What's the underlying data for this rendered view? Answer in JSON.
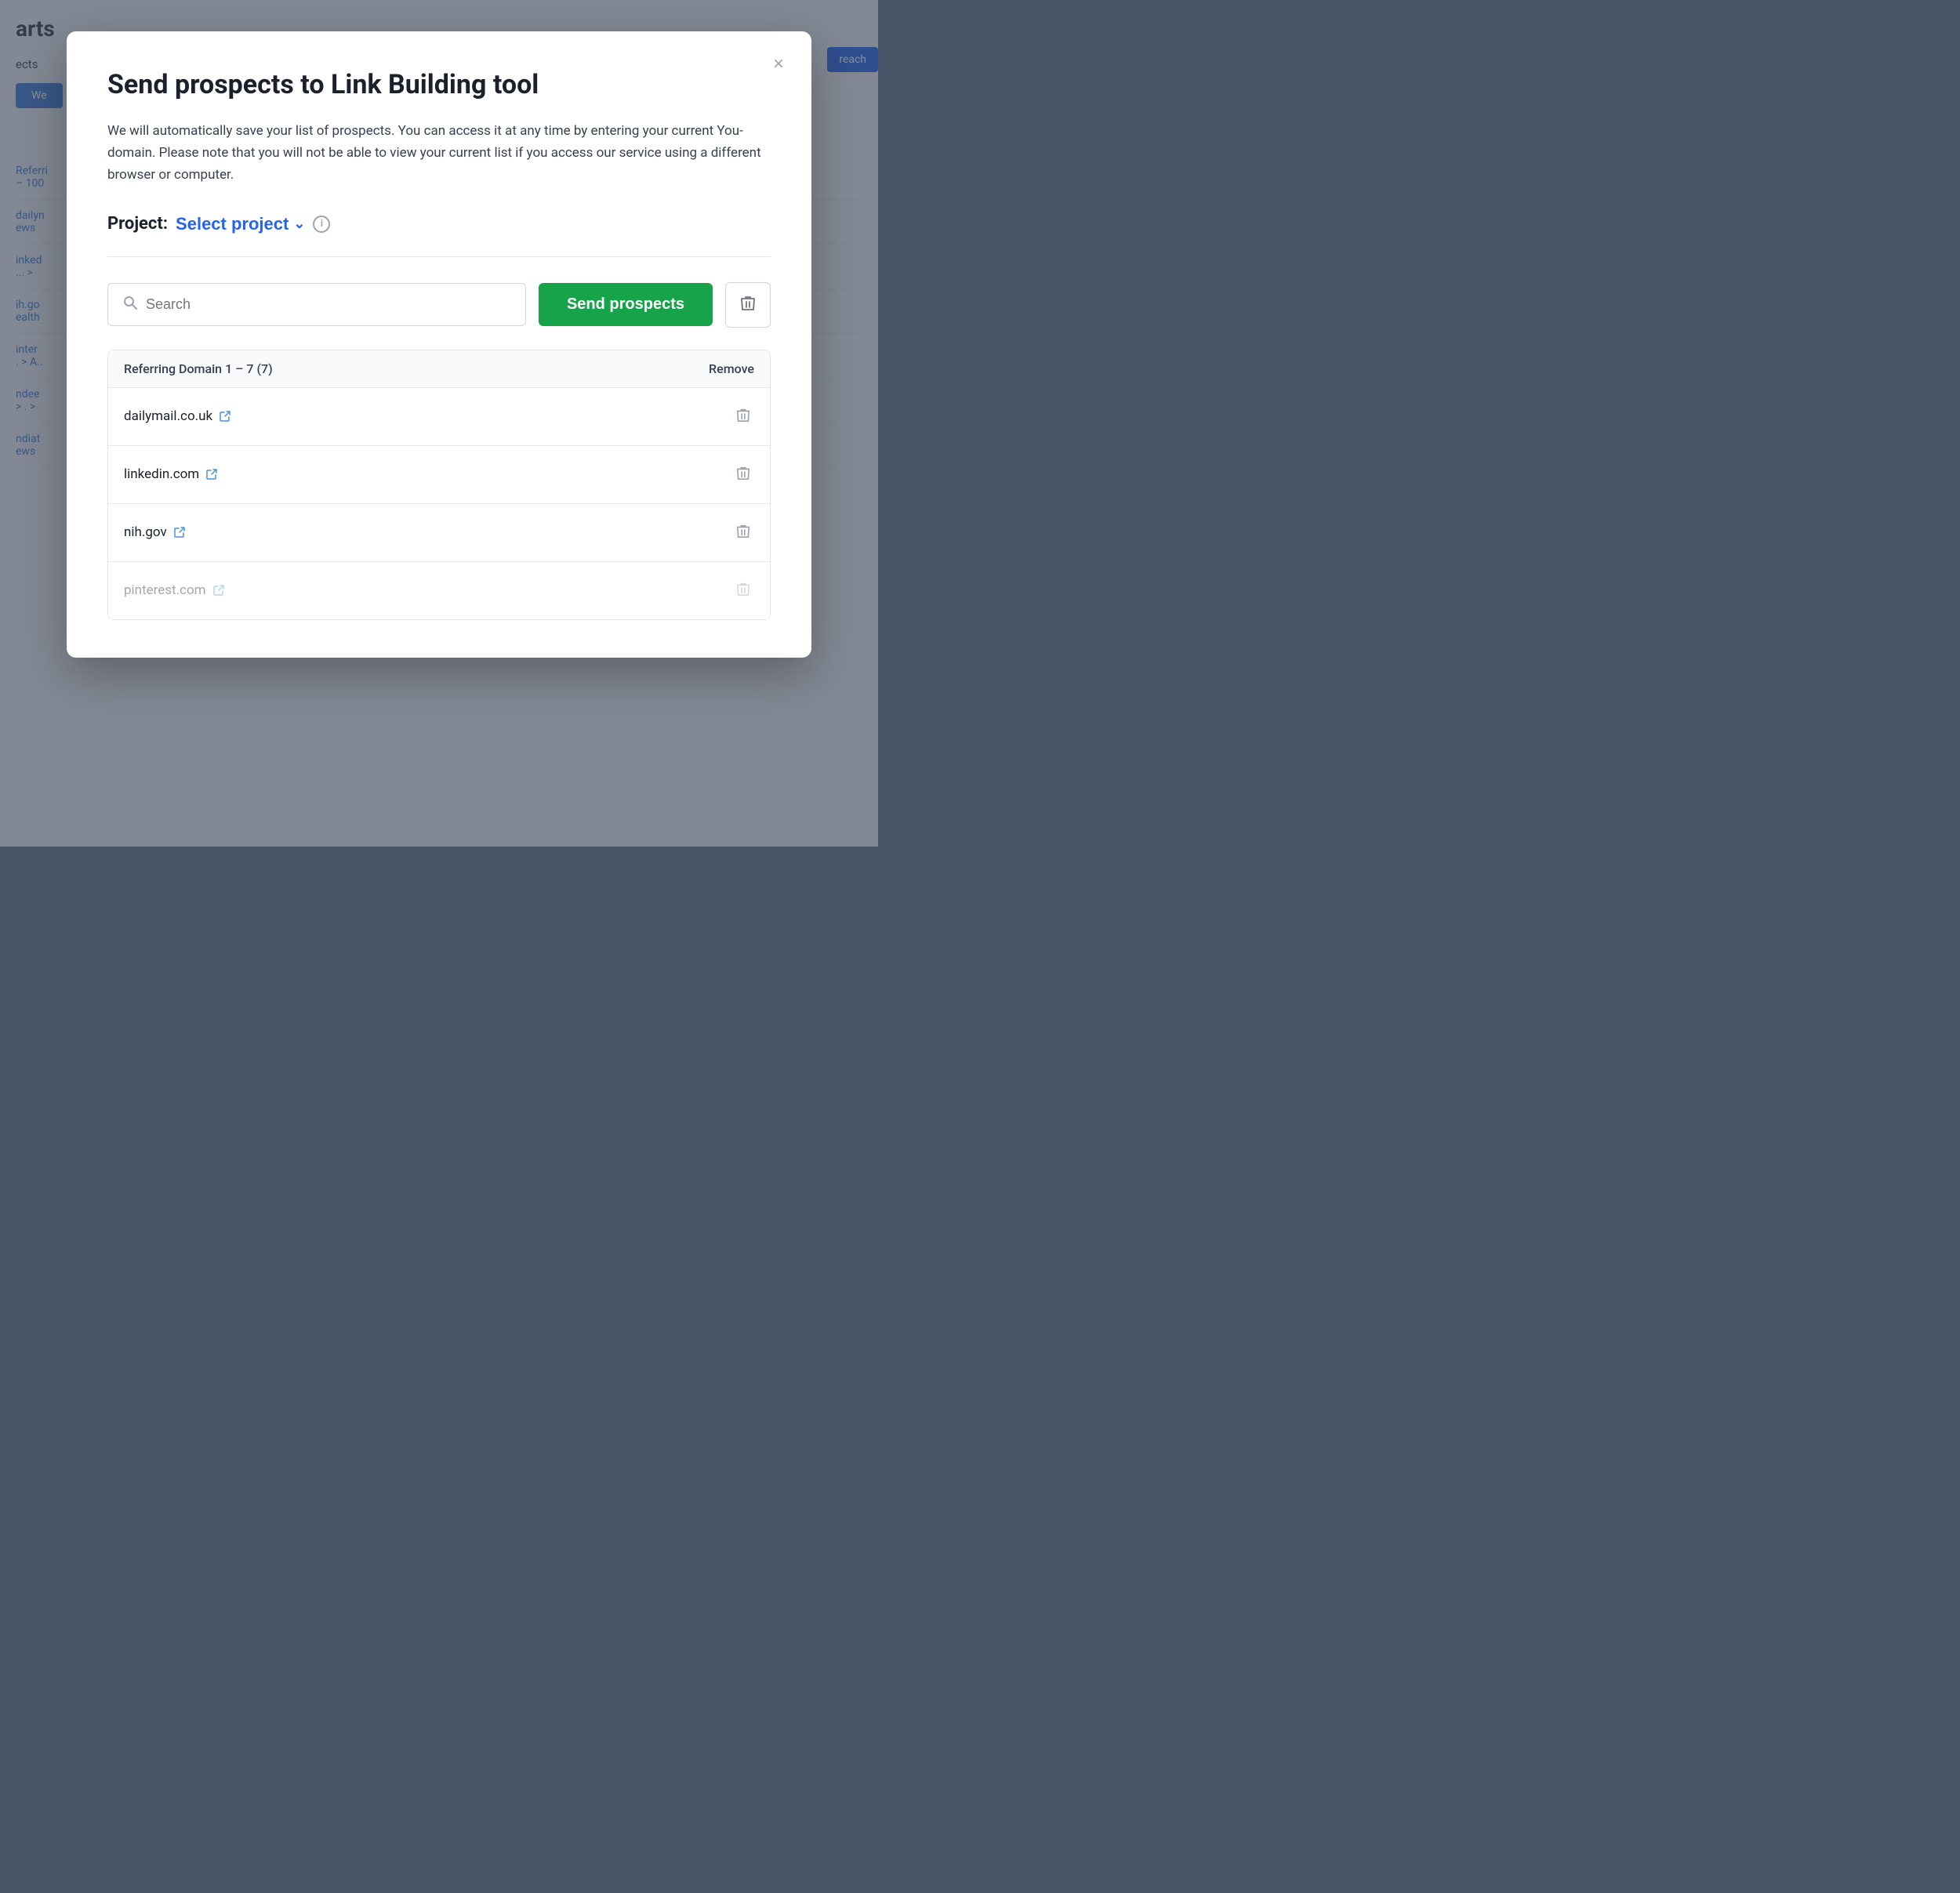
{
  "background": {
    "title": "arts",
    "subtitle": "ects"
  },
  "modal": {
    "title": "Send prospects to Link Building tool",
    "description": "We will automatically save your list of prospects. You can access it at any time by entering your current You-domain. Please note that you will not be able to view your current list if you access our service using a different browser or computer.",
    "close_label": "×",
    "project_label": "Project:",
    "project_select_label": "Select project",
    "info_icon_label": "i",
    "search_placeholder": "Search",
    "send_button_label": "Send prospects",
    "table": {
      "header_domain": "Referring Domain 1 – 7 (7)",
      "header_remove": "Remove",
      "rows": [
        {
          "domain": "dailymail.co.uk",
          "faded": false
        },
        {
          "domain": "linkedin.com",
          "faded": false
        },
        {
          "domain": "nih.gov",
          "faded": false
        },
        {
          "domain": "pinterest.com",
          "faded": true
        }
      ]
    }
  },
  "colors": {
    "green": "#16a34a",
    "blue": "#2563eb",
    "light_gray": "#e5e7eb",
    "medium_gray": "#9ca3af",
    "dark_text": "#1a202c"
  }
}
